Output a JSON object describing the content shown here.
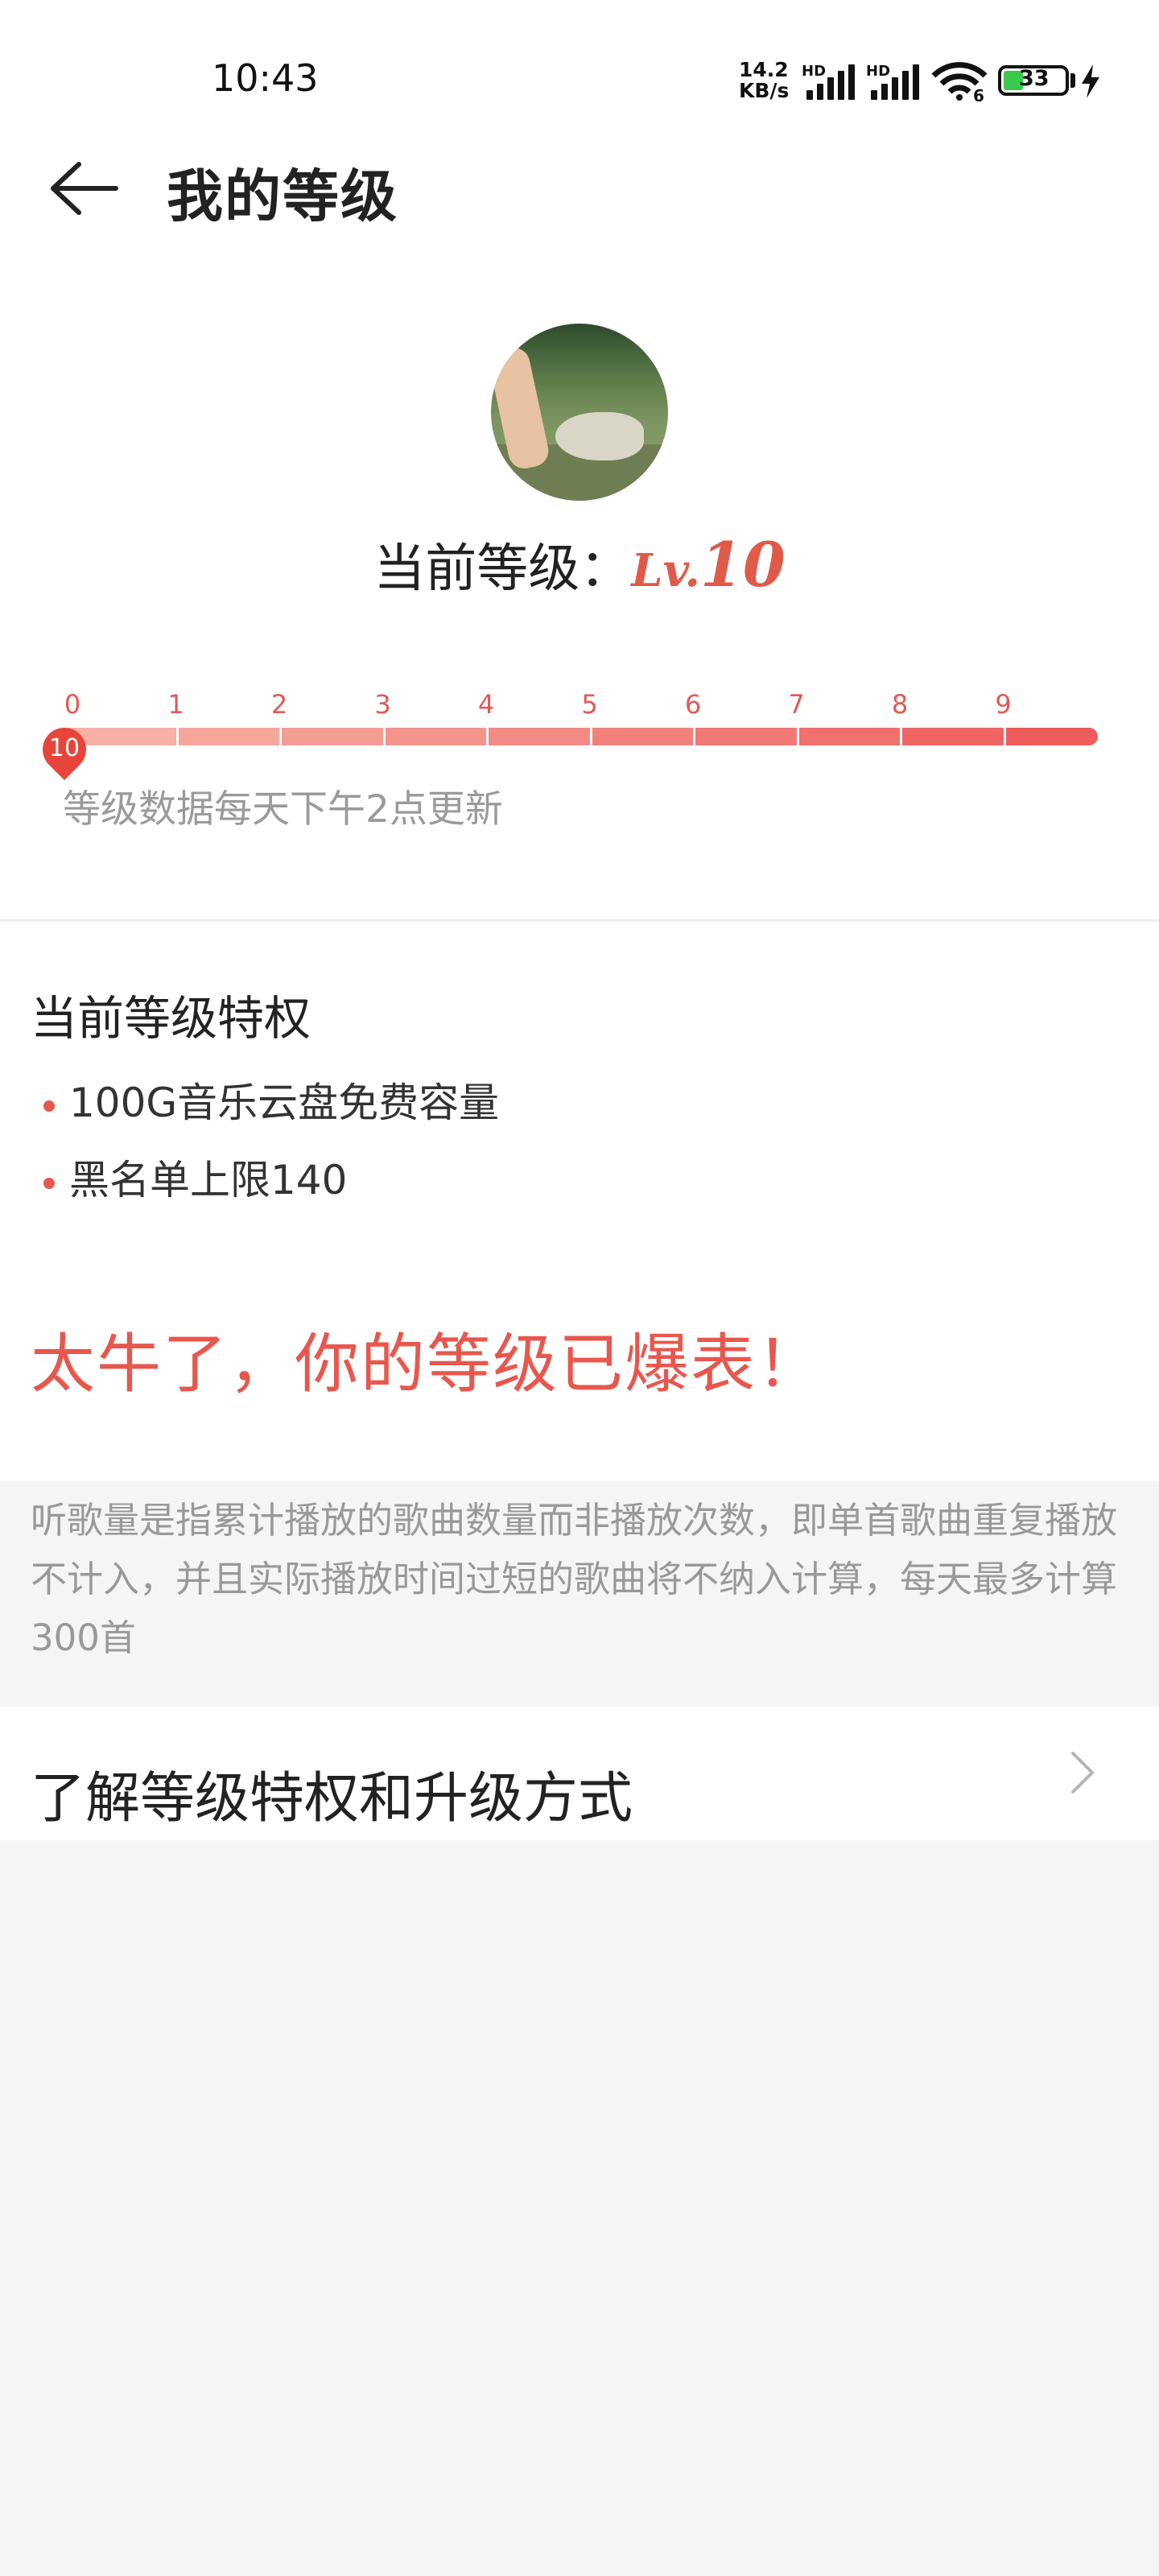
{
  "status_bar": {
    "time": "10:43",
    "net_speed_value": "14.2",
    "net_speed_unit": "KB/s",
    "hd_1": "HD",
    "hd_2": "HD",
    "wifi_badge": "6",
    "battery": "33"
  },
  "header": {
    "title": "我的等级"
  },
  "level": {
    "label": "当前等级：",
    "prefix": "Lv.",
    "number": "10",
    "accent_color": "#e05a4a"
  },
  "progress": {
    "ticks": [
      "0",
      "1",
      "2",
      "3",
      "4",
      "5",
      "6",
      "7",
      "8",
      "9"
    ],
    "current_marker": "10",
    "progress_fraction": 1.0,
    "gradient_from": "#f6b0a4",
    "gradient_to": "#ef5c5c"
  },
  "update_note": "等级数据每天下午2点更新",
  "privileges": {
    "title": "当前等级特权",
    "items": [
      "100G音乐云盘免费容量",
      "黑名单上限140"
    ]
  },
  "boast": "太牛了，你的等级已爆表！",
  "info": "听歌量是指累计播放的歌曲数量而非播放次数，即单首歌曲重复播放不计入，并且实际播放时间过短的歌曲将不纳入计算，每天最多计算300首",
  "link": {
    "label": "了解等级特权和升级方式"
  },
  "icons": {
    "back": "back-arrow-icon",
    "chevron": "chevron-right-icon",
    "wifi": "wifi-icon",
    "battery": "battery-icon",
    "charging": "charging-bolt-icon"
  }
}
